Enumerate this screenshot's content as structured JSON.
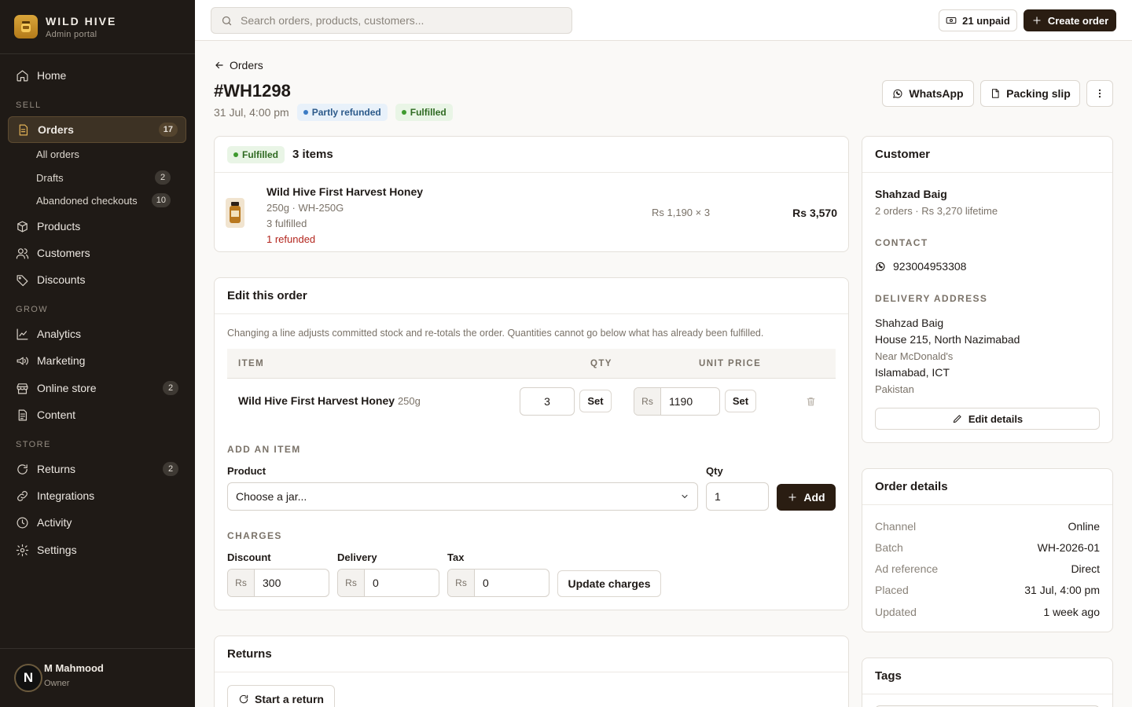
{
  "brand": {
    "name": "WILD HIVE",
    "subtitle": "Admin portal"
  },
  "nav": {
    "home": "Home",
    "section_sell": "SELL",
    "orders": "Orders",
    "orders_count": "17",
    "all_orders": "All orders",
    "drafts": "Drafts",
    "drafts_count": "2",
    "abandoned": "Abandoned checkouts",
    "abandoned_count": "10",
    "products": "Products",
    "customers": "Customers",
    "discounts": "Discounts",
    "section_grow": "GROW",
    "analytics": "Analytics",
    "marketing": "Marketing",
    "online_store": "Online store",
    "online_store_count": "2",
    "content": "Content",
    "section_store": "STORE",
    "returns": "Returns",
    "returns_count": "2",
    "integrations": "Integrations",
    "activity": "Activity",
    "settings": "Settings"
  },
  "user": {
    "initial": "N",
    "name": "M Mahmood",
    "role": "Owner"
  },
  "topbar": {
    "search_placeholder": "Search orders, products, customers...",
    "unpaid": "21 unpaid",
    "create_order": "Create order"
  },
  "order": {
    "back": "Orders",
    "number": "#WH1298",
    "date": "31 Jul, 4:00 pm",
    "status_refund": "Partly refunded",
    "status_fulfilled": "Fulfilled",
    "whatsapp": "WhatsApp",
    "packing_slip": "Packing slip"
  },
  "fulfilled_card": {
    "status": "Fulfilled",
    "items_count": "3 items",
    "item": {
      "name": "Wild Hive First Harvest Honey",
      "variant": "250g · WH-250G",
      "fulfilled": "3 fulfilled",
      "refunded": "1 refunded",
      "unit": "Rs 1,190 × 3",
      "total": "Rs 3,570"
    }
  },
  "edit_order": {
    "title": "Edit this order",
    "note": "Changing a line adjusts committed stock and re-totals the order. Quantities cannot go below what has already been fulfilled.",
    "col_item": "ITEM",
    "col_qty": "QTY",
    "col_price": "UNIT PRICE",
    "line": {
      "name": "Wild Hive First Harvest Honey",
      "size": "250g",
      "qty": "3",
      "price": "1190",
      "currency": "Rs",
      "set": "Set"
    },
    "add_title": "ADD AN ITEM",
    "product_label": "Product",
    "product_value": "Choose a jar...",
    "qty_label": "Qty",
    "qty_value": "1",
    "add_button": "Add",
    "charges_title": "CHARGES",
    "discount_label": "Discount",
    "discount_value": "300",
    "delivery_label": "Delivery",
    "delivery_value": "0",
    "tax_label": "Tax",
    "tax_value": "0",
    "update_button": "Update charges"
  },
  "returns": {
    "title": "Returns",
    "start": "Start a return"
  },
  "customer": {
    "title": "Customer",
    "name": "Shahzad Baig",
    "summary": "2 orders · Rs 3,270 lifetime",
    "contact_title": "CONTACT",
    "phone": "923004953308",
    "address_title": "DELIVERY ADDRESS",
    "address": [
      "Shahzad Baig",
      "House 215, North Nazimabad",
      "Near McDonald's",
      "Islamabad, ICT",
      "Pakistan"
    ],
    "edit": "Edit details"
  },
  "order_details": {
    "title": "Order details",
    "rows": [
      {
        "k": "Channel",
        "v": "Online"
      },
      {
        "k": "Batch",
        "v": "WH-2026-01"
      },
      {
        "k": "Ad reference",
        "v": "Direct"
      },
      {
        "k": "Placed",
        "v": "31 Jul, 4:00 pm"
      },
      {
        "k": "Updated",
        "v": "1 week ago"
      }
    ]
  },
  "tags": {
    "title": "Tags"
  },
  "colors": {
    "sidebar": "#1f1a16",
    "accent": "#e2b256",
    "primary_button": "#2a1d12",
    "refund_red": "#b3261e"
  }
}
